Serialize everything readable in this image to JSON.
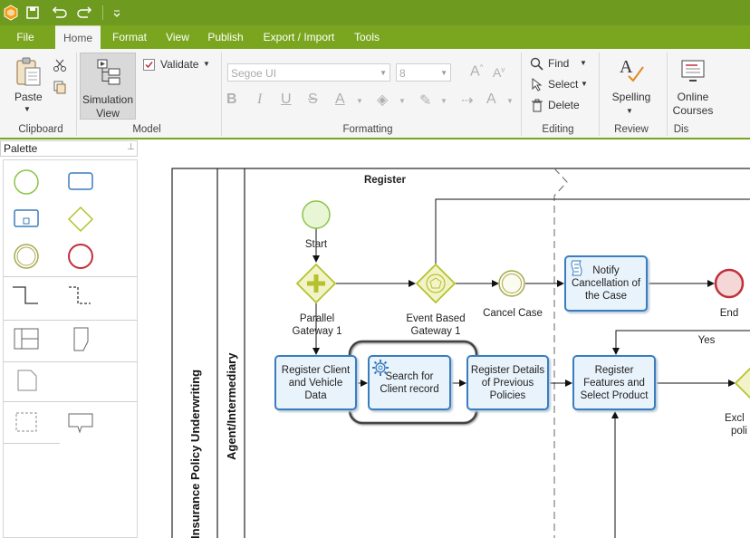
{
  "titlebar": {
    "icons": [
      "app-logo-icon",
      "save-icon",
      "undo-icon",
      "redo-icon",
      "customize-icon"
    ]
  },
  "menu": {
    "file": "File",
    "tabs": [
      "Home",
      "Format",
      "View",
      "Publish",
      "Export / Import",
      "Tools"
    ]
  },
  "ribbon": {
    "clipboard": {
      "paste": "Paste",
      "group": "Clipboard"
    },
    "model": {
      "simulation_line1": "Simulation",
      "simulation_line2": "View",
      "validate": "Validate",
      "group": "Model"
    },
    "formatting": {
      "font": "Segoe UI",
      "size": "8",
      "group": "Formatting"
    },
    "editing": {
      "find": "Find",
      "select": "Select",
      "delete": "Delete",
      "group": "Editing"
    },
    "review": {
      "spelling": "Spelling",
      "group": "Review"
    },
    "dis": {
      "online1": "Online",
      "online2": "Courses",
      "group": "Dis"
    }
  },
  "palette": {
    "title": "Palette",
    "pin_icon": "pin-icon"
  },
  "diagram": {
    "pool": "Insurance Policy Underwriting",
    "lane": "Agent/Intermediary",
    "stage": "Register",
    "start": "Start",
    "parallel_gw_1": "Parallel",
    "parallel_gw_2": "Gateway 1",
    "event_gw_1": "Event Based",
    "event_gw_2": "Gateway 1",
    "cancel_case": "Cancel Case",
    "notify_1": "Notify",
    "notify_2": "Cancellation of",
    "notify_3": "the Case",
    "end": "End",
    "yes": "Yes",
    "task_register_client_1": "Register Client",
    "task_register_client_2": "and Vehicle",
    "task_register_client_3": "Data",
    "task_search_1": "Search for",
    "task_search_2": "Client record",
    "task_details_1": "Register Details",
    "task_details_2": "of Previous",
    "task_details_3": "Policies",
    "task_features_1": "Register",
    "task_features_2": "Features and",
    "task_features_3": "Select Product",
    "exclusive_1": "Excl",
    "exclusive_2": "poli"
  },
  "colors": {
    "brand_green": "#7aa61f",
    "task_border": "#3a7dbf",
    "task_fill": "#e9f3fb",
    "gateway": "#b5c22d",
    "end_red": "#c0303a"
  }
}
